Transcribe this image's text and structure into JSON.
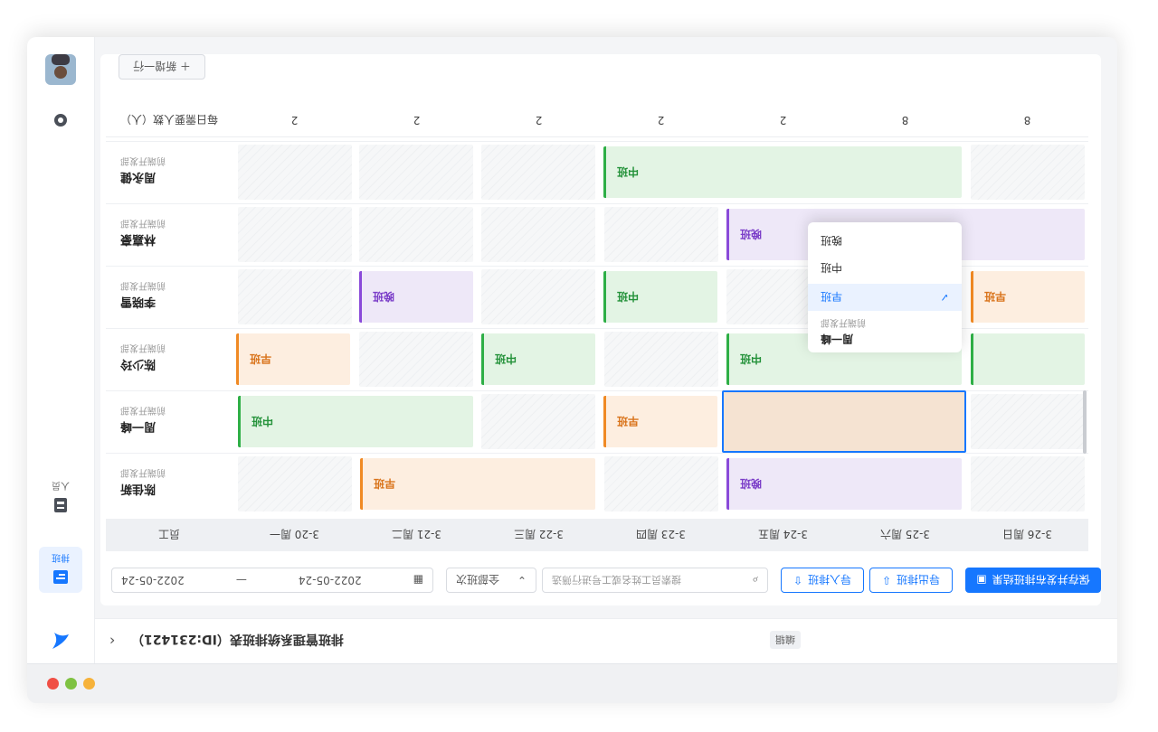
{
  "window": {
    "traffic_lights": [
      {
        "name": "close",
        "color": "#f04f45"
      },
      {
        "name": "minimize",
        "color": "#7fc242"
      },
      {
        "name": "maximize",
        "color": "#f6b23a"
      }
    ]
  },
  "header": {
    "back_icon": "‹",
    "title": "排班管理系统排班表（ID:231421）",
    "badge": "编辑"
  },
  "sidebar": {
    "items": [
      {
        "name": "logo",
        "icon": "bird-logo-icon"
      },
      {
        "name": "schedule",
        "label": "排班",
        "icon": "calendar-icon",
        "active": true
      },
      {
        "name": "people",
        "label": "人员",
        "icon": "user-icon"
      },
      {
        "name": "settings",
        "icon": "gear-icon"
      },
      {
        "name": "avatar",
        "icon": "avatar"
      }
    ]
  },
  "toolbar": {
    "primary_button": "保存并发布排班结果",
    "button_2": "导入排班",
    "button_3": "导出排班",
    "search_placeholder": "搜索员工姓名或工号进行筛选",
    "filter_label": "全部班次",
    "date_from": "2022-05-24",
    "date_to": "2022-05-24",
    "date_separator": "—",
    "add_button": "＋ 新增一行"
  },
  "grid": {
    "corner_label": "员工",
    "days": [
      "3-20 周一",
      "3-21 周二",
      "3-22 周三",
      "3-23 周四",
      "3-24 周五",
      "3-25 周六",
      "3-26 周日"
    ],
    "employees": [
      {
        "name": "陈佳新",
        "dept": "前端开发部"
      },
      {
        "name": "周一峰",
        "dept": "前端开发部"
      },
      {
        "name": "陈少玲",
        "dept": "前端开发部"
      },
      {
        "name": "李晓雪",
        "dept": "前端开发部"
      },
      {
        "name": "林嘉豪",
        "dept": "前端开发部"
      },
      {
        "name": "周永健",
        "dept": "前端开发部"
      }
    ],
    "shift_labels": {
      "early": "早班",
      "mid": "中班",
      "late": "晚班"
    },
    "colors": {
      "early": "#f08a24",
      "mid": "#2eaf46",
      "late": "#8a4ad9",
      "accent": "#1677ff"
    },
    "footer_label": "每日需要人数（人）",
    "footer_counts": [
      "2",
      "2",
      "2",
      "2",
      "2",
      "8",
      "8"
    ]
  },
  "menu": {
    "employee_name": "周一峰",
    "employee_dept": "前端开发部",
    "options": [
      "早班",
      "中班",
      "晚班"
    ],
    "selected": "早班"
  }
}
